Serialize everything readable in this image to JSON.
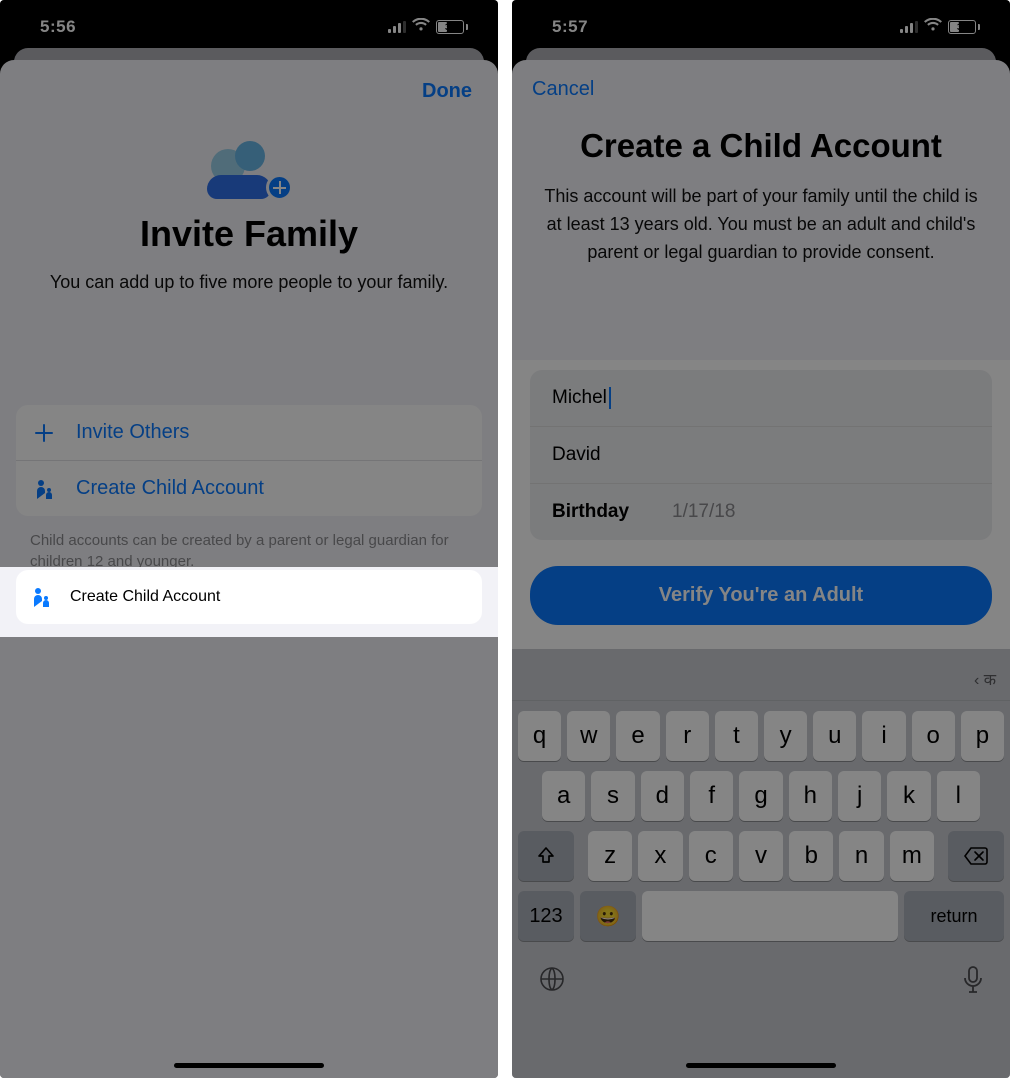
{
  "left": {
    "status": {
      "time": "5:56",
      "battery": "32"
    },
    "done_label": "Done",
    "title": "Invite Family",
    "subtitle": "You can add up to five more people to your family.",
    "rows": {
      "invite_others": "Invite Others",
      "create_child": "Create Child Account"
    },
    "footer": "Child accounts can be created by a parent or legal guardian for children 12 and younger."
  },
  "right": {
    "status": {
      "time": "5:57",
      "battery": "31"
    },
    "cancel_label": "Cancel",
    "title": "Create a Child Account",
    "subtitle": "This account will be part of your family until the child is at least 13 years old. You must be an adult and child's parent or legal guardian to provide consent.",
    "form": {
      "first_name": "Michel",
      "last_name": "David",
      "birthday_label": "Birthday",
      "birthday_value": "1/17/18"
    },
    "verify_label": "Verify You're an Adult",
    "keyboard": {
      "suggestion_hint": "‹ क",
      "row1": [
        "q",
        "w",
        "e",
        "r",
        "t",
        "y",
        "u",
        "i",
        "o",
        "p"
      ],
      "row2": [
        "a",
        "s",
        "d",
        "f",
        "g",
        "h",
        "j",
        "k",
        "l"
      ],
      "row3": [
        "z",
        "x",
        "c",
        "v",
        "b",
        "n",
        "m"
      ],
      "mode_label": "123",
      "return_label": "return"
    }
  }
}
